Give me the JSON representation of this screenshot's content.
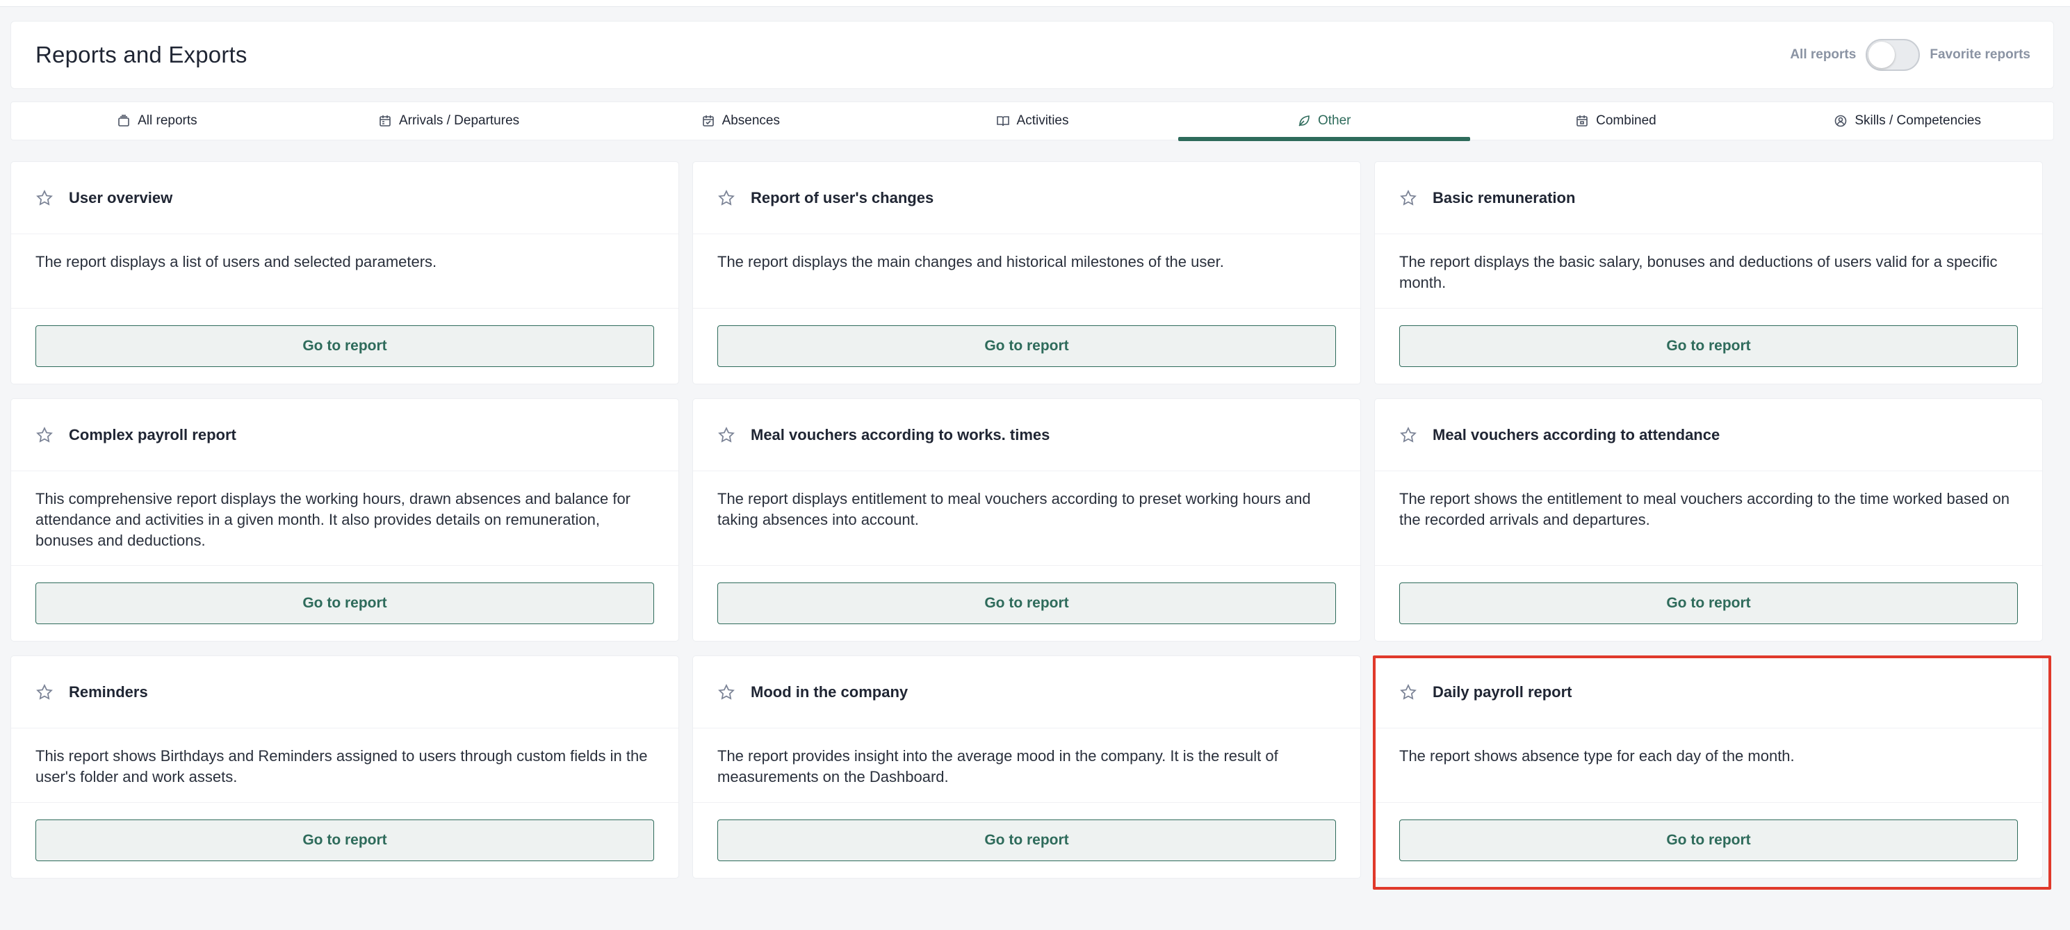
{
  "page": {
    "title": "Reports and Exports",
    "toggle": {
      "left_label": "All reports",
      "right_label": "Favorite reports",
      "state": "off"
    }
  },
  "tabs": [
    {
      "label": "All reports",
      "icon": "reports-stack-icon",
      "active": false
    },
    {
      "label": "Arrivals / Departures",
      "icon": "calendar-icon",
      "active": false
    },
    {
      "label": "Absences",
      "icon": "calendar-check-icon",
      "active": false
    },
    {
      "label": "Activities",
      "icon": "book-icon",
      "active": false
    },
    {
      "label": "Other",
      "icon": "leaf-icon",
      "active": true
    },
    {
      "label": "Combined",
      "icon": "calendar-grid-icon",
      "active": false
    },
    {
      "label": "Skills / Competencies",
      "icon": "badge-icon",
      "active": false
    }
  ],
  "cards": [
    {
      "title": "User overview",
      "description": "The report displays a list of users and selected parameters.",
      "button": "Go to report"
    },
    {
      "title": "Report of user's changes",
      "description": "The report displays the main changes and historical milestones of the user.",
      "button": "Go to report"
    },
    {
      "title": "Basic remuneration",
      "description": "The report displays the basic salary, bonuses and deductions of users valid for a specific month.",
      "button": "Go to report"
    },
    {
      "title": "Complex payroll report",
      "description": "This comprehensive report displays the working hours, drawn absences and balance for attendance and activities in a given month. It also provides details on remuneration, bonuses and deductions.",
      "button": "Go to report"
    },
    {
      "title": "Meal vouchers according to works. times",
      "description": "The report displays entitlement to meal vouchers according to preset working hours and taking absences into account.",
      "button": "Go to report"
    },
    {
      "title": "Meal vouchers according to attendance",
      "description": "The report shows the entitlement to meal vouchers according to the time worked based on the recorded arrivals and departures.",
      "button": "Go to report"
    },
    {
      "title": "Reminders",
      "description": "This report shows Birthdays and Reminders assigned to users through custom fields in the user's folder and work assets.",
      "button": "Go to report"
    },
    {
      "title": "Mood in the company",
      "description": "The report provides insight into the average mood in the company. It is the result of measurements on the Dashboard.",
      "button": "Go to report"
    },
    {
      "title": "Daily payroll report",
      "description": "The report shows absence type for each day of the month.",
      "button": "Go to report"
    }
  ],
  "colors": {
    "accent": "#2e6b5b",
    "highlight": "#e0392b"
  },
  "icons": {
    "favorite": "star-icon"
  }
}
